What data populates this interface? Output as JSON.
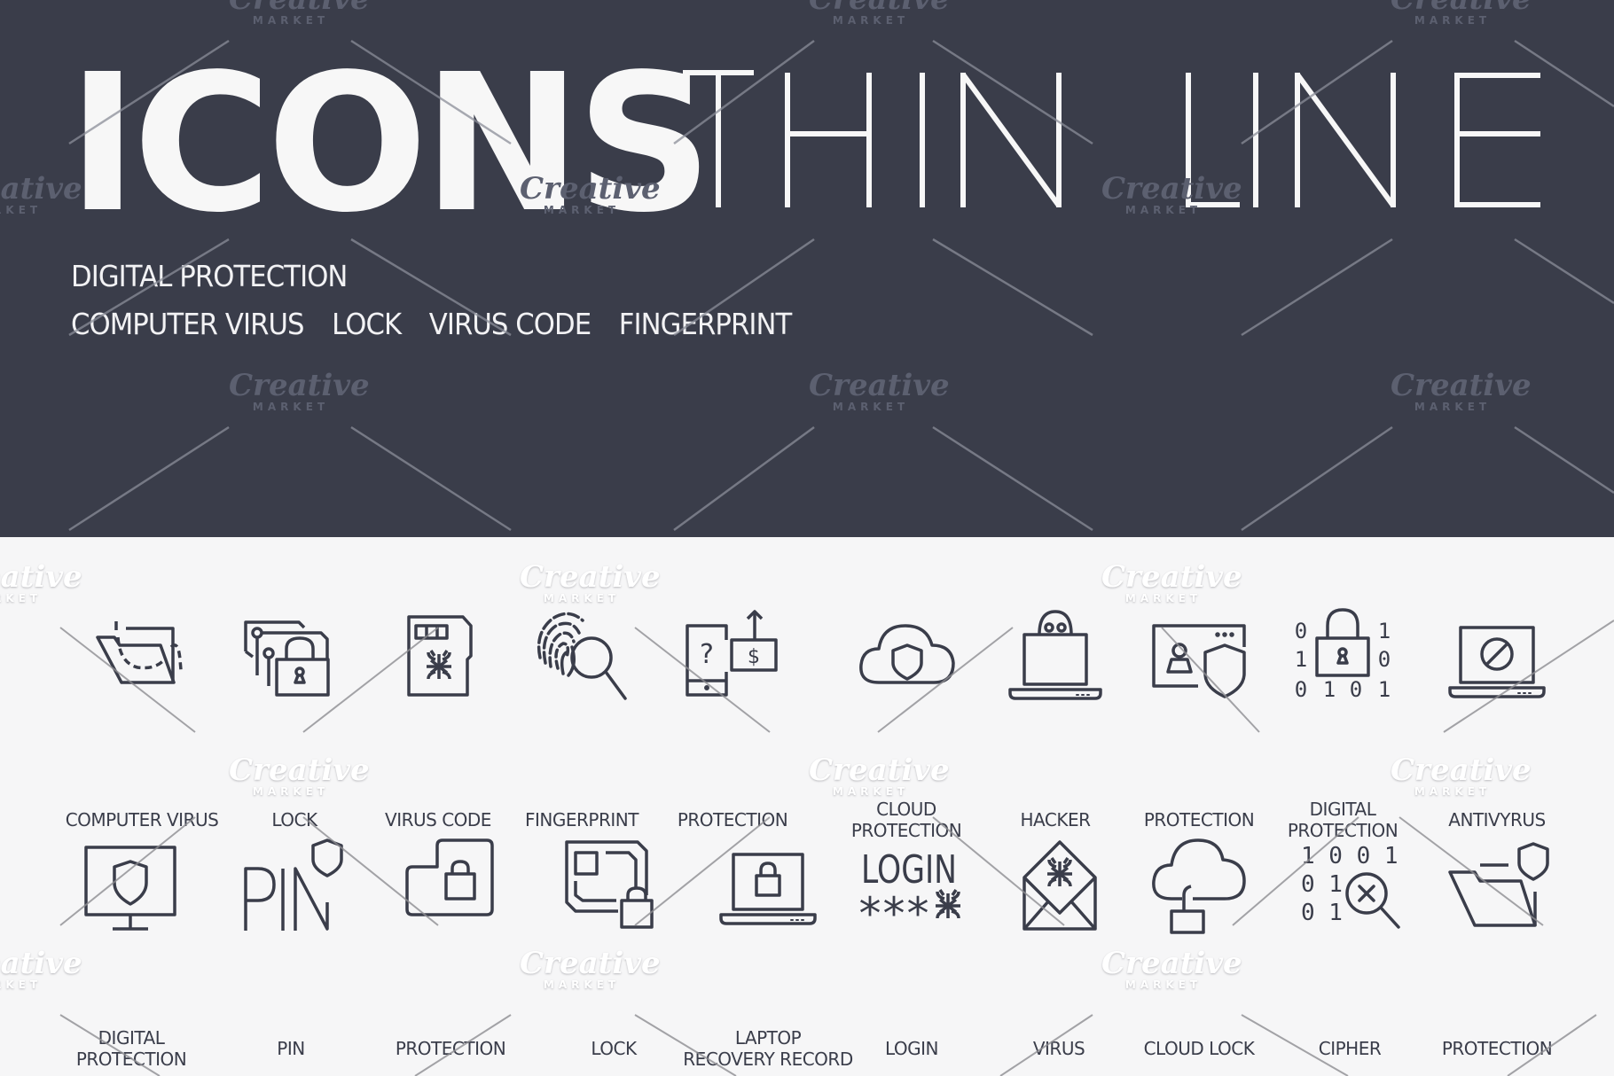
{
  "header": {
    "title_bold": "ICONS",
    "title_thin": "THIN LINE",
    "subtitle_line1": "DIGITAL PROTECTION",
    "subtitle_keywords": [
      "COMPUTER VIRUS",
      "LOCK",
      "VIRUS CODE",
      "FINGERPRINT"
    ]
  },
  "colors": {
    "header_bg": "#3a3d4a",
    "page_bg": "#f6f6f7",
    "icon_stroke": "#3a3d4a",
    "title_text": "#f7f7f7"
  },
  "icons_row1": [
    {
      "icon": "folder-virus-icon",
      "label": [
        "COMPUTER VIRUS"
      ]
    },
    {
      "icon": "circuit-lock-icon",
      "label": [
        "LOCK"
      ]
    },
    {
      "icon": "sd-card-bug-icon",
      "label": [
        "VIRUS CODE"
      ]
    },
    {
      "icon": "fingerprint-magnifier-icon",
      "label": [
        "FINGERPRINT"
      ]
    },
    {
      "icon": "tablet-dollar-icon",
      "label": [
        "PROTECTION"
      ]
    },
    {
      "icon": "cloud-shield-icon",
      "label": [
        "CLOUD",
        "PROTECTION"
      ]
    },
    {
      "icon": "laptop-hacker-icon",
      "label": [
        "HACKER"
      ]
    },
    {
      "icon": "window-user-shield-icon",
      "label": [
        "PROTECTION"
      ]
    },
    {
      "icon": "binary-padlock-icon",
      "label": [
        "DIGITAL",
        "PROTECTION"
      ]
    },
    {
      "icon": "laptop-forbidden-icon",
      "label": [
        "ANTIVYRUS"
      ]
    }
  ],
  "icons_row2": [
    {
      "icon": "monitor-shield-icon",
      "label": [
        "DIGITAL",
        "PROTECTION"
      ]
    },
    {
      "icon": "pin-shield-icon",
      "label": [
        "PIN"
      ]
    },
    {
      "icon": "folder-padlock-icon",
      "label": [
        "PROTECTION"
      ]
    },
    {
      "icon": "chip-padlock-icon",
      "label": [
        "LOCK"
      ]
    },
    {
      "icon": "laptop-padlock-icon",
      "label": [
        "LAPTOP",
        "RECOVERY RECORD"
      ]
    },
    {
      "icon": "login-password-icon",
      "label": [
        "LOGIN"
      ]
    },
    {
      "icon": "envelope-bug-icon",
      "label": [
        "VIRUS"
      ]
    },
    {
      "icon": "cloud-unlocked-icon",
      "label": [
        "CLOUD LOCK"
      ]
    },
    {
      "icon": "binary-search-cross-icon",
      "label": [
        "CIPHER"
      ]
    },
    {
      "icon": "folder-shield-icon",
      "label": [
        "PROTECTION"
      ]
    }
  ],
  "icon_text": {
    "pin": "PIN",
    "login": "LOGIN",
    "login_mask": "***",
    "binary_row1": [
      "0",
      "1"
    ],
    "binary_row2": [
      "1",
      "0"
    ],
    "binary_row3": [
      "0",
      "1",
      "0",
      "1"
    ],
    "cipher_row1": "1 0 0 1",
    "cipher_row2": "0 1",
    "cipher_row3": "0 1",
    "dollar": "$",
    "question": "?"
  },
  "watermark": {
    "brand": "Creative",
    "sub": "MARKET"
  }
}
